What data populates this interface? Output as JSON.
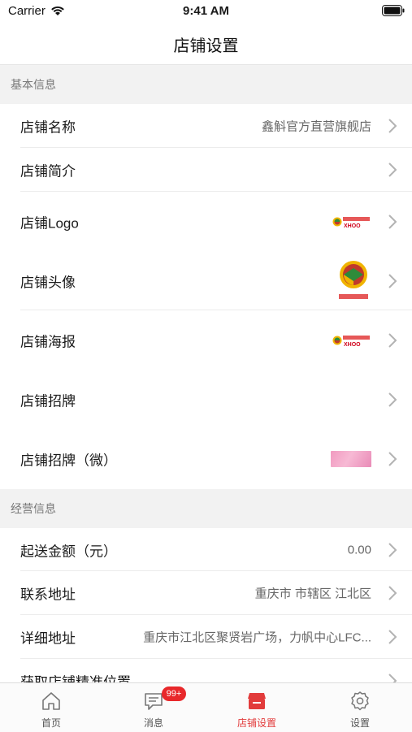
{
  "status_bar": {
    "carrier": "Carrier",
    "time": "9:41 AM"
  },
  "nav": {
    "title": "店铺设置"
  },
  "sections": [
    {
      "header": "基本信息",
      "rows": [
        {
          "label": "店铺名称",
          "value": "鑫斛官方直营旗舰店"
        },
        {
          "label": "店铺简介"
        },
        {
          "label": "店铺Logo",
          "image": "logo-thumbnail",
          "image_text": "鑫斛大药房 XHOO"
        },
        {
          "label": "店铺头像",
          "image": "avatar-thumbnail",
          "image_text": "鑫斛大药房"
        },
        {
          "label": "店铺海报",
          "image": "poster-thumbnail",
          "image_text": "鑫斛大药房 XHOO"
        },
        {
          "label": "店铺招牌"
        },
        {
          "label": "店铺招牌（微）",
          "image": "banner-thumbnail"
        }
      ]
    },
    {
      "header": "经营信息",
      "rows": [
        {
          "label": "起送金额（元）",
          "value": "0.00"
        },
        {
          "label": "联系地址",
          "value": "重庆市 市辖区 江北区"
        },
        {
          "label": "详细地址",
          "value": "重庆市江北区聚贤岩广场，力帆中心LFC..."
        },
        {
          "label": "获取店铺精准位置"
        }
      ]
    }
  ],
  "tabbar": {
    "items": [
      {
        "label": "首页",
        "icon": "home-icon"
      },
      {
        "label": "消息",
        "icon": "message-icon",
        "badge": "99+"
      },
      {
        "label": "店铺设置",
        "icon": "store-icon",
        "active": true
      },
      {
        "label": "设置",
        "icon": "settings-icon"
      }
    ]
  },
  "colors": {
    "accent": "#e23b3b",
    "badge": "#e8282b",
    "background": "#f2f2f2"
  }
}
